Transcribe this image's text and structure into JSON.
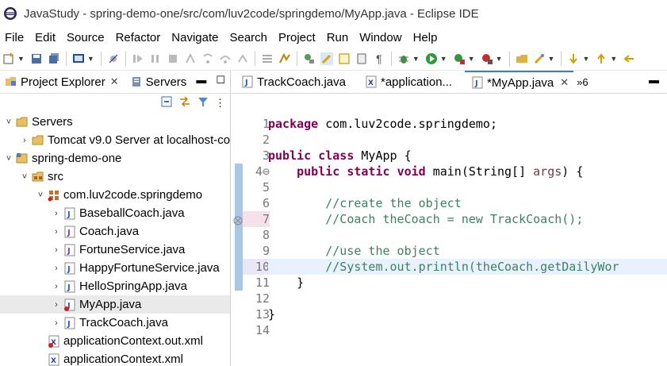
{
  "window": {
    "title": "JavaStudy - spring-demo-one/src/com/luv2code/springdemo/MyApp.java - Eclipse IDE"
  },
  "menubar": {
    "items": [
      "File",
      "Edit",
      "Source",
      "Refactor",
      "Navigate",
      "Search",
      "Project",
      "Run",
      "Window",
      "Help"
    ]
  },
  "left_panel": {
    "tabs": [
      {
        "label": "Project Explorer",
        "close": "✕"
      },
      {
        "label": "Servers"
      }
    ],
    "tree": [
      {
        "label": "Servers",
        "level": 0,
        "twisty": "˅",
        "icon": "folder"
      },
      {
        "label": "Tomcat v9.0 Server at localhost-co",
        "level": 1,
        "twisty": "›",
        "icon": "folder"
      },
      {
        "label": "spring-demo-one",
        "level": 0,
        "twisty": "˅",
        "icon": "project"
      },
      {
        "label": "src",
        "level": 1,
        "twisty": "˅",
        "icon": "src-folder"
      },
      {
        "label": "com.luv2code.springdemo",
        "level": 2,
        "twisty": "˅",
        "icon": "package"
      },
      {
        "label": "BaseballCoach.java",
        "level": 3,
        "twisty": "›",
        "icon": "java-file"
      },
      {
        "label": "Coach.java",
        "level": 3,
        "twisty": "›",
        "icon": "interface-file"
      },
      {
        "label": "FortuneService.java",
        "level": 3,
        "twisty": "›",
        "icon": "interface-file"
      },
      {
        "label": "HappyFortuneService.java",
        "level": 3,
        "twisty": "›",
        "icon": "java-file"
      },
      {
        "label": "HelloSpringApp.java",
        "level": 3,
        "twisty": "›",
        "icon": "java-file"
      },
      {
        "label": "MyApp.java",
        "level": 3,
        "twisty": "›",
        "icon": "java-file-error",
        "selected": true
      },
      {
        "label": "TrackCoach.java",
        "level": 3,
        "twisty": "›",
        "icon": "java-file"
      },
      {
        "label": "applicationContext.out.xml",
        "level": 2,
        "twisty": "",
        "icon": "xml-file-error"
      },
      {
        "label": "applicationContext.xml",
        "level": 2,
        "twisty": "",
        "icon": "xml-file"
      }
    ]
  },
  "editor": {
    "tabs": [
      {
        "label": "TrackCoach.java",
        "active": false
      },
      {
        "label": "*applicationContext.xml",
        "display": "*application...",
        "active": false
      },
      {
        "label": "*MyApp.java",
        "active": true,
        "close": "✕"
      }
    ],
    "overflow": "»6",
    "current_line": 10,
    "lines": [
      {
        "n": "1",
        "tokens": [
          {
            "t": "kw",
            "v": "package"
          },
          {
            "t": "",
            "v": " com.luv2code.springdemo;"
          }
        ]
      },
      {
        "n": "2",
        "tokens": []
      },
      {
        "n": "3",
        "tokens": [
          {
            "t": "kw",
            "v": "public"
          },
          {
            "t": "",
            "v": " "
          },
          {
            "t": "kw",
            "v": "class"
          },
          {
            "t": "",
            "v": " MyApp {"
          }
        ]
      },
      {
        "n": "4⊖",
        "tokens": [
          {
            "t": "",
            "v": "    "
          },
          {
            "t": "kw",
            "v": "public"
          },
          {
            "t": "",
            "v": " "
          },
          {
            "t": "kw",
            "v": "static"
          },
          {
            "t": "",
            "v": " "
          },
          {
            "t": "kw",
            "v": "void"
          },
          {
            "t": "",
            "v": " main(String[] "
          },
          {
            "t": "pm",
            "v": "args"
          },
          {
            "t": "",
            "v": ") {"
          }
        ]
      },
      {
        "n": "5",
        "tokens": []
      },
      {
        "n": "6",
        "tokens": [
          {
            "t": "",
            "v": "        "
          },
          {
            "t": "cm",
            "v": "//create the object"
          }
        ]
      },
      {
        "n": "7",
        "tokens": [
          {
            "t": "",
            "v": "        "
          },
          {
            "t": "cm",
            "v": "//Coach theCoach = new TrackCoach();"
          }
        ]
      },
      {
        "n": "8",
        "tokens": []
      },
      {
        "n": "9",
        "tokens": [
          {
            "t": "",
            "v": "        "
          },
          {
            "t": "cm",
            "v": "//use the object"
          }
        ]
      },
      {
        "n": "10",
        "tokens": [
          {
            "t": "",
            "v": "        "
          },
          {
            "t": "cm",
            "v": "//System.out.println(theCoach.getDailyWor"
          }
        ]
      },
      {
        "n": "11",
        "tokens": [
          {
            "t": "",
            "v": "    }"
          }
        ]
      },
      {
        "n": "12",
        "tokens": []
      },
      {
        "n": "13",
        "tokens": [
          {
            "t": "",
            "v": "}"
          }
        ]
      },
      {
        "n": "14",
        "tokens": []
      }
    ]
  },
  "colors": {
    "keyword": "#7f0055",
    "comment": "#3f7f5f",
    "param": "#6a3e3e",
    "tab_accent": "#3d7ec8"
  }
}
